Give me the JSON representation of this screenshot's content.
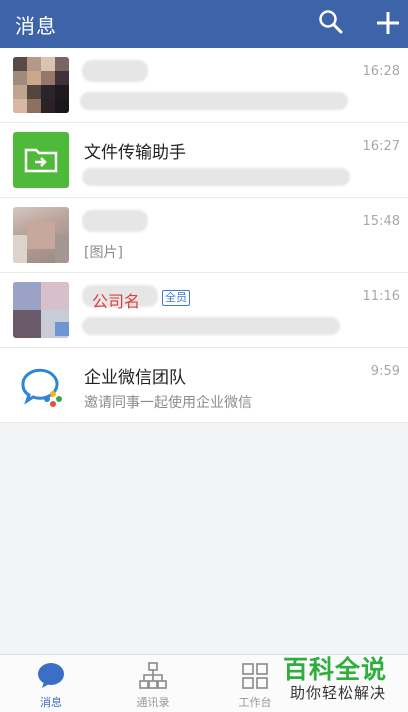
{
  "header": {
    "title": "消息"
  },
  "chats": [
    {
      "name": "",
      "time": "16:28",
      "preview": ""
    },
    {
      "name": "文件传输助手",
      "time": "16:27",
      "preview": ""
    },
    {
      "name": "",
      "time": "15:48",
      "preview": "[图片]"
    },
    {
      "name": "公司名",
      "badge": "全员",
      "time": "11:16",
      "preview": ""
    },
    {
      "name": "企业微信团队",
      "time": "9:59",
      "preview": "邀请同事一起使用企业微信"
    }
  ],
  "tabs": [
    {
      "label": "消息"
    },
    {
      "label": "通讯录"
    },
    {
      "label": "工作台"
    },
    {
      "label": ""
    }
  ],
  "watermark": {
    "line1": "百科全说",
    "line2": "助你轻松解决"
  },
  "colors": {
    "header": "#3d64a8",
    "accent": "#3b6fc4",
    "file_helper": "#4fba3a"
  }
}
